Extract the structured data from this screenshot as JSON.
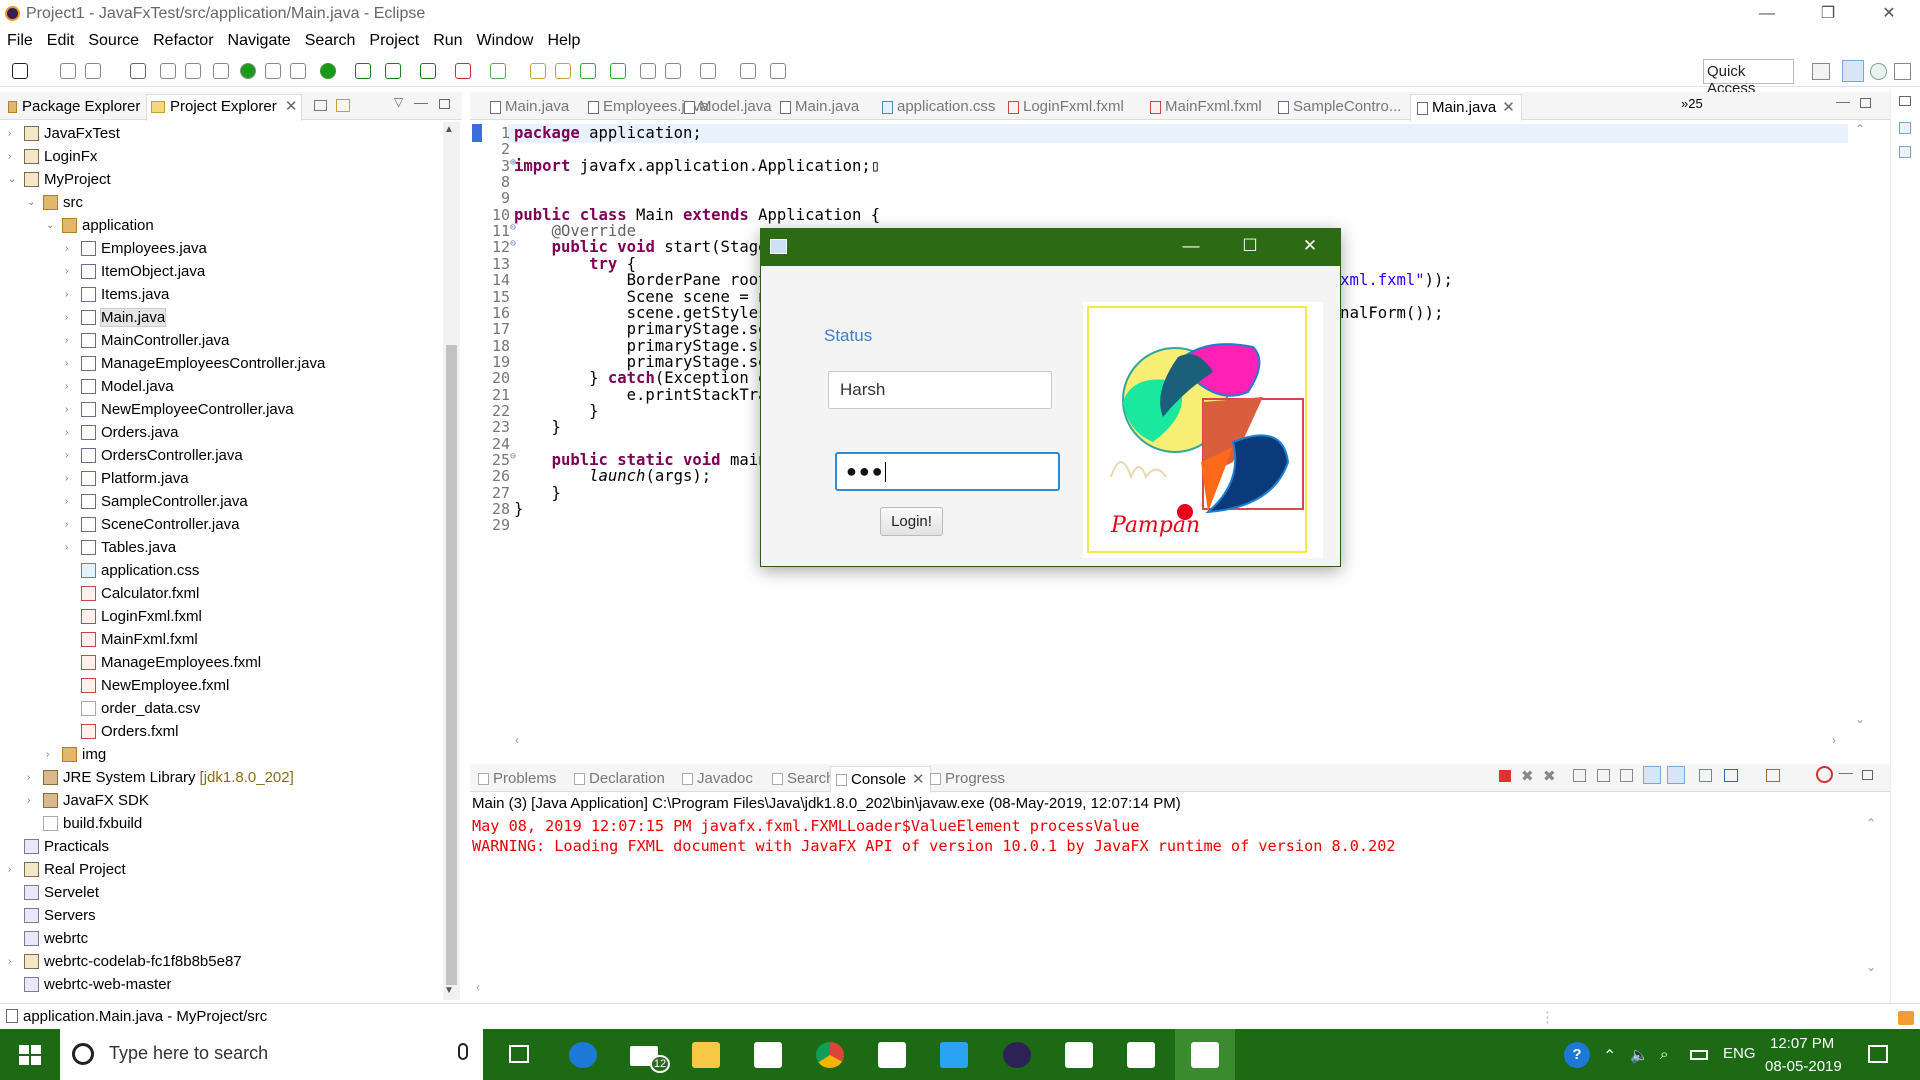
{
  "window": {
    "title": "Project1 - JavaFxTest/src/application/Main.java - Eclipse"
  },
  "menu": [
    "File",
    "Edit",
    "Source",
    "Refactor",
    "Navigate",
    "Search",
    "Project",
    "Run",
    "Window",
    "Help"
  ],
  "toolbar": {
    "quick_access": "Quick Access"
  },
  "left_tabs": {
    "package_explorer": "Package Explorer",
    "project_explorer": "Project Explorer"
  },
  "tree": [
    {
      "label": "JavaFxTest",
      "indent": 0,
      "arrow": "›",
      "icon": "jproj"
    },
    {
      "label": "LoginFx",
      "indent": 0,
      "arrow": "›",
      "icon": "jproj"
    },
    {
      "label": "MyProject",
      "indent": 0,
      "arrow": "⌄",
      "icon": "jproj"
    },
    {
      "label": "src",
      "indent": 1,
      "arrow": "⌄",
      "icon": "pkg"
    },
    {
      "label": "application",
      "indent": 2,
      "arrow": "⌄",
      "icon": "pkg"
    },
    {
      "label": "Employees.java",
      "indent": 3,
      "arrow": "›",
      "icon": "java"
    },
    {
      "label": "ItemObject.java",
      "indent": 3,
      "arrow": "›",
      "icon": "java"
    },
    {
      "label": "Items.java",
      "indent": 3,
      "arrow": "›",
      "icon": "java"
    },
    {
      "label": "Main.java",
      "indent": 3,
      "arrow": "›",
      "icon": "java",
      "selected": true
    },
    {
      "label": "MainController.java",
      "indent": 3,
      "arrow": "›",
      "icon": "java"
    },
    {
      "label": "ManageEmployeesController.java",
      "indent": 3,
      "arrow": "›",
      "icon": "java"
    },
    {
      "label": "Model.java",
      "indent": 3,
      "arrow": "›",
      "icon": "java"
    },
    {
      "label": "NewEmployeeController.java",
      "indent": 3,
      "arrow": "›",
      "icon": "java"
    },
    {
      "label": "Orders.java",
      "indent": 3,
      "arrow": "›",
      "icon": "java"
    },
    {
      "label": "OrdersController.java",
      "indent": 3,
      "arrow": "›",
      "icon": "java"
    },
    {
      "label": "Platform.java",
      "indent": 3,
      "arrow": "›",
      "icon": "java"
    },
    {
      "label": "SampleController.java",
      "indent": 3,
      "arrow": "›",
      "icon": "java"
    },
    {
      "label": "SceneController.java",
      "indent": 3,
      "arrow": "›",
      "icon": "java"
    },
    {
      "label": "Tables.java",
      "indent": 3,
      "arrow": "›",
      "icon": "java"
    },
    {
      "label": "application.css",
      "indent": 3,
      "arrow": "",
      "icon": "css"
    },
    {
      "label": "Calculator.fxml",
      "indent": 3,
      "arrow": "",
      "icon": "fxml"
    },
    {
      "label": "LoginFxml.fxml",
      "indent": 3,
      "arrow": "",
      "icon": "fxml"
    },
    {
      "label": "MainFxml.fxml",
      "indent": 3,
      "arrow": "",
      "icon": "fxml"
    },
    {
      "label": "ManageEmployees.fxml",
      "indent": 3,
      "arrow": "",
      "icon": "fxml"
    },
    {
      "label": "NewEmployee.fxml",
      "indent": 3,
      "arrow": "",
      "icon": "fxml"
    },
    {
      "label": "order_data.csv",
      "indent": 3,
      "arrow": "",
      "icon": "csv"
    },
    {
      "label": "Orders.fxml",
      "indent": 3,
      "arrow": "",
      "icon": "fxml"
    },
    {
      "label": "img",
      "indent": 2,
      "arrow": "›",
      "icon": "pkg"
    },
    {
      "label": "JRE System Library",
      "suffix": "[jdk1.8.0_202]",
      "indent": 1,
      "arrow": "›",
      "icon": "lib"
    },
    {
      "label": "JavaFX SDK",
      "indent": 1,
      "arrow": "›",
      "icon": "lib"
    },
    {
      "label": "build.fxbuild",
      "indent": 1,
      "arrow": "",
      "icon": "csv"
    },
    {
      "label": "Practicals",
      "indent": 0,
      "arrow": "",
      "icon": "proj"
    },
    {
      "label": "Real Project",
      "indent": 0,
      "arrow": "›",
      "icon": "jproj"
    },
    {
      "label": "Servelet",
      "indent": 0,
      "arrow": "",
      "icon": "proj"
    },
    {
      "label": "Servers",
      "indent": 0,
      "arrow": "",
      "icon": "proj"
    },
    {
      "label": "webrtc",
      "indent": 0,
      "arrow": "",
      "icon": "proj"
    },
    {
      "label": "webrtc-codelab-fc1f8b8b5e87",
      "indent": 0,
      "arrow": "›",
      "icon": "jproj"
    },
    {
      "label": "webrtc-web-master",
      "indent": 0,
      "arrow": "",
      "icon": "proj"
    }
  ],
  "editor_tabs": [
    {
      "label": "Main.java",
      "icon": "java"
    },
    {
      "label": "Employees.java",
      "icon": "java"
    },
    {
      "label": "Model.java",
      "icon": "java"
    },
    {
      "label": "Main.java",
      "icon": "java"
    },
    {
      "label": "application.css",
      "icon": "css"
    },
    {
      "label": "LoginFxml.fxml",
      "icon": "fxml"
    },
    {
      "label": "MainFxml.fxml",
      "icon": "fxml"
    },
    {
      "label": "SampleContro...",
      "icon": "java"
    },
    {
      "label": "Main.java",
      "icon": "java",
      "active": true
    }
  ],
  "editor_overflow": "»25",
  "code_lines": [
    {
      "n": "1",
      "html": "<span class='kw'>package</span> application;"
    },
    {
      "n": "2",
      "html": ""
    },
    {
      "n": "3",
      "fold": "⊕",
      "html": "<span class='kw'>import</span> javafx.application.Application;▯"
    },
    {
      "n": "8",
      "html": ""
    },
    {
      "n": "9",
      "html": ""
    },
    {
      "n": "10",
      "html": "<span class='kw'>public class</span> Main <span class='kw'>extends</span> Application {"
    },
    {
      "n": "11",
      "fold": "⊖",
      "html": "    <span class='ann'>@Override</span>"
    },
    {
      "n": "12",
      "fold": "⊖",
      "html": "    <span class='kw'>public void</span> start(Stage primaryStage) {"
    },
    {
      "n": "13",
      "html": "        <span class='kw'>try</span> {"
    },
    {
      "n": "14",
      "html": "            BorderPane root = (BorderPane)FXMLLoader.load(getClass().getResource(<span class='str'>\"LoginFxml.fxml\"</span>));"
    },
    {
      "n": "15",
      "html": "            Scene scene = <span class='kw'>new</span> Scene(root,400,400);"
    },
    {
      "n": "16",
      "html": "            scene.getStylesheets().add(getClass().getResource(<span class='str'>\"application.css\"</span>).toExternalForm());"
    },
    {
      "n": "17",
      "html": "            primaryStage.setScene(scene);"
    },
    {
      "n": "18",
      "html": "            primaryStage.show();"
    },
    {
      "n": "19",
      "html": "            primaryStage.setTitle();"
    },
    {
      "n": "20",
      "html": "        } <span class='kw'>catch</span>(Exception e) {"
    },
    {
      "n": "21",
      "html": "            e.printStackTrace();"
    },
    {
      "n": "22",
      "html": "        }"
    },
    {
      "n": "23",
      "html": "    }"
    },
    {
      "n": "24",
      "html": ""
    },
    {
      "n": "25",
      "fold": "⊖",
      "html": "    <span class='kw'>public static void</span> main(String[] args) {"
    },
    {
      "n": "26",
      "html": "        <span class='it'>launch</span>(args);"
    },
    {
      "n": "27",
      "html": "    }"
    },
    {
      "n": "28",
      "html": "}"
    },
    {
      "n": "29",
      "html": ""
    }
  ],
  "bottom_tabs": [
    {
      "label": "Problems"
    },
    {
      "label": "Declaration"
    },
    {
      "label": "Javadoc"
    },
    {
      "label": "Search"
    },
    {
      "label": "Console",
      "active": true
    },
    {
      "label": "Progress"
    }
  ],
  "console": {
    "header": "Main (3) [Java Application] C:\\Program Files\\Java\\jdk1.8.0_202\\bin\\javaw.exe (08-May-2019, 12:07:14 PM)",
    "line1": "May 08, 2019 12:07:15 PM javafx.fxml.FXMLLoader$ValueElement processValue",
    "line2": "WARNING: Loading FXML document with JavaFX API of version 10.0.1 by JavaFX runtime of version 8.0.202"
  },
  "statusbar": {
    "text": "application.Main.java - MyProject/src"
  },
  "dialog": {
    "status_label": "Status",
    "username": "Harsh",
    "password_mask": "●●●",
    "login_button": "Login!",
    "logo_text": "Pampan"
  },
  "taskbar": {
    "search_placeholder": "Type here to search",
    "mail_badge": "12",
    "lang": "ENG",
    "time": "12:07 PM",
    "date": "08-05-2019"
  },
  "colors": {
    "taskbar_bg": "#1c6b14",
    "dialog_titlebar": "#2c6a14",
    "keyword": "#7f0055",
    "string": "#2a00ff",
    "console_error": "#e00000",
    "status_label": "#3d7fc8"
  }
}
